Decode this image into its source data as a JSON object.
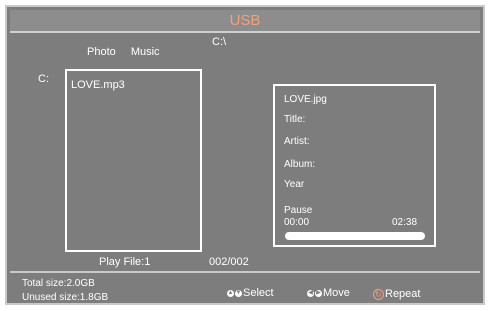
{
  "header": {
    "title": "USB"
  },
  "browser": {
    "path": "C:\\",
    "tabs": [
      "Photo",
      "Music"
    ],
    "drive": "C:",
    "files": [
      "LOVE.mp3"
    ],
    "play_file": "Play File:1",
    "count": "002/002"
  },
  "info": {
    "filename": "LOVE.jpg",
    "title_label": "Title:",
    "artist_label": "Artist:",
    "album_label": "Album:",
    "year_label": "Year",
    "status": "Pause",
    "time_current": "00:00",
    "time_total": "02:38",
    "progress": 0
  },
  "footer": {
    "total_size": "Total size:2.0GB",
    "unused_size": "Unused size:1.8GB",
    "select_label": "Select",
    "move_label": "Move",
    "repeat_label": "Repeat",
    "select_icon": "up-down-arrows-icon",
    "move_icon": "left-right-arrows-icon",
    "repeat_icon": "repeat-icon"
  },
  "colors": {
    "background": "#7d7d7d",
    "accent": "#f3a27b",
    "border": "#ffffff"
  }
}
